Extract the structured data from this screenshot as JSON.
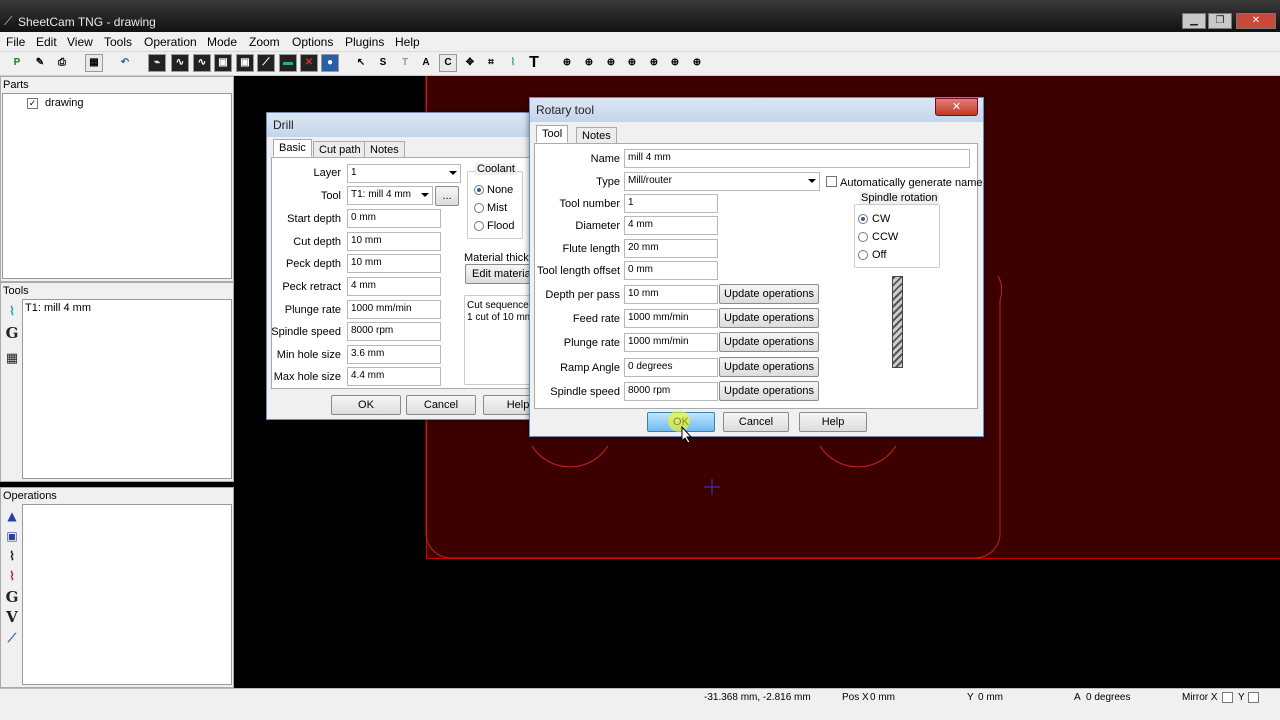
{
  "window": {
    "title": "SheetCam TNG - drawing",
    "min": "▁",
    "max": "❐",
    "close": "✕"
  },
  "menu": [
    "File",
    "Edit",
    "View",
    "Tools",
    "Operation",
    "Mode",
    "Zoom",
    "Options",
    "Plugins",
    "Help"
  ],
  "parts": {
    "title": "Parts",
    "item": "drawing"
  },
  "tools": {
    "title": "Tools",
    "item": "T1: mill 4 mm"
  },
  "operations": {
    "title": "Operations"
  },
  "status": {
    "coords": "-31.368 mm, -2.816 mm",
    "pos_label": "Pos X",
    "pos_val": "0 mm",
    "y_label": "Y",
    "y_val": "0 mm",
    "a_label": "A",
    "a_val": "0 degrees",
    "mirror_x": "Mirror X",
    "mirror_y": "Y"
  },
  "drill": {
    "title": "Drill",
    "tabs": [
      "Basic",
      "Cut path",
      "Notes"
    ],
    "fields": [
      {
        "label": "Layer",
        "value": "1"
      },
      {
        "label": "Tool",
        "value": "T1: mill 4 mm"
      },
      {
        "label": "Start depth",
        "value": "0 mm"
      },
      {
        "label": "Cut depth",
        "value": "10 mm"
      },
      {
        "label": "Peck depth",
        "value": "10 mm"
      },
      {
        "label": "Peck retract",
        "value": "4 mm"
      },
      {
        "label": "Plunge rate",
        "value": "1000 mm/min"
      },
      {
        "label": "Spindle speed",
        "value": "8000 rpm"
      },
      {
        "label": "Min hole size",
        "value": "3.6 mm"
      },
      {
        "label": "Max hole size",
        "value": "4.4 mm"
      }
    ],
    "tool_btn": "...",
    "coolant": {
      "title": "Coolant",
      "options": [
        "None",
        "Mist",
        "Flood"
      ],
      "selected": "None"
    },
    "material_label": "Material thickn",
    "edit_material": "Edit material",
    "cut_seq_title": "Cut sequence",
    "cut_seq_text": "1 cut of 10 mm",
    "ok": "OK",
    "cancel": "Cancel",
    "help": "Help"
  },
  "rotary": {
    "title": "Rotary tool",
    "close": "✕",
    "tabs": [
      "Tool",
      "Notes"
    ],
    "name_label": "Name",
    "name": "mill 4 mm",
    "type_label": "Type",
    "type": "Mill/router",
    "autogen": "Automatically generate name",
    "fields": [
      {
        "label": "Tool number",
        "value": "1"
      },
      {
        "label": "Diameter",
        "value": "4 mm"
      },
      {
        "label": "Flute length",
        "value": "20 mm"
      },
      {
        "label": "Tool length offset",
        "value": "0 mm"
      }
    ],
    "update_fields": [
      {
        "label": "Depth per pass",
        "value": "10 mm"
      },
      {
        "label": "Feed rate",
        "value": "1000 mm/min"
      },
      {
        "label": "Plunge rate",
        "value": "1000 mm/min"
      },
      {
        "label": "Ramp Angle",
        "value": "0 degrees"
      },
      {
        "label": "Spindle speed",
        "value": "8000 rpm"
      }
    ],
    "update_btn": "Update operations",
    "spindle": {
      "title": "Spindle rotation",
      "options": [
        "CW",
        "CCW",
        "Off"
      ],
      "selected": "CW"
    },
    "ok": "OK",
    "cancel": "Cancel",
    "help": "Help"
  }
}
